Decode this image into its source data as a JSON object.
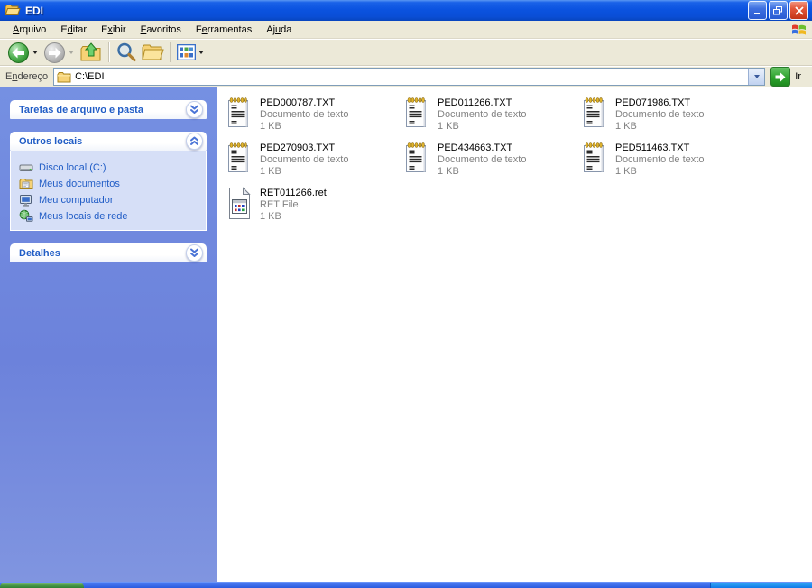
{
  "window": {
    "title": "EDI"
  },
  "menu": {
    "items": [
      {
        "label": "Arquivo",
        "underline": 0
      },
      {
        "label": "Editar",
        "underline": 1
      },
      {
        "label": "Exibir",
        "underline": 1
      },
      {
        "label": "Favoritos",
        "underline": 0
      },
      {
        "label": "Ferramentas",
        "underline": 1
      },
      {
        "label": "Ajuda",
        "underline": 2
      }
    ]
  },
  "toolbar": {
    "buttons": [
      {
        "name": "back",
        "icon": "back-icon",
        "enabled": true,
        "dropdown": true
      },
      {
        "name": "forward",
        "icon": "forward-icon",
        "enabled": false,
        "dropdown": true
      },
      {
        "name": "up",
        "icon": "up-folder-icon",
        "enabled": true,
        "dropdown": false
      },
      {
        "name": "search",
        "icon": "search-icon",
        "enabled": true,
        "dropdown": false
      },
      {
        "name": "folders",
        "icon": "folders-icon",
        "enabled": true,
        "dropdown": false
      },
      {
        "name": "views",
        "icon": "views-icon",
        "enabled": true,
        "dropdown": true
      }
    ]
  },
  "address": {
    "label": "Endereço",
    "label_underline": 1,
    "value": "C:\\EDI",
    "go_label": "Ir"
  },
  "sidebar": {
    "panels": [
      {
        "title": "Tarefas de arquivo e pasta",
        "state": "collapsed",
        "items": []
      },
      {
        "title": "Outros locais",
        "state": "expanded",
        "items": [
          {
            "label": "Disco local (C:)",
            "icon": "disk-drive-icon"
          },
          {
            "label": "Meus documentos",
            "icon": "documents-folder-icon"
          },
          {
            "label": "Meu computador",
            "icon": "my-computer-icon"
          },
          {
            "label": "Meus locais de rede",
            "icon": "network-places-icon"
          }
        ]
      },
      {
        "title": "Detalhes",
        "state": "collapsed",
        "items": []
      }
    ]
  },
  "files": [
    {
      "name": "PED000787.TXT",
      "type": "Documento de texto",
      "size": "1 KB",
      "icon": "text-document-icon"
    },
    {
      "name": "PED011266.TXT",
      "type": "Documento de texto",
      "size": "1 KB",
      "icon": "text-document-icon"
    },
    {
      "name": "PED071986.TXT",
      "type": "Documento de texto",
      "size": "1 KB",
      "icon": "text-document-icon"
    },
    {
      "name": "PED270903.TXT",
      "type": "Documento de texto",
      "size": "1 KB",
      "icon": "text-document-icon"
    },
    {
      "name": "PED434663.TXT",
      "type": "Documento de texto",
      "size": "1 KB",
      "icon": "text-document-icon"
    },
    {
      "name": "PED511463.TXT",
      "type": "Documento de texto",
      "size": "1 KB",
      "icon": "text-document-icon"
    },
    {
      "name": "RET011266.ret",
      "type": "RET File",
      "size": "1 KB",
      "icon": "unknown-file-icon"
    }
  ],
  "colors": {
    "titlebar_blue": "#0B53E0",
    "sidebar_blue": "#6E87DE",
    "panel_text_blue": "#215DC6",
    "panel_body_blue": "#D6DFF7",
    "taskbar_blue": "#2A5ADE",
    "start_green": "#2F8032",
    "tray_blue": "#0E78E8",
    "go_green": "#2FA32F",
    "meta_gray": "#828282"
  }
}
